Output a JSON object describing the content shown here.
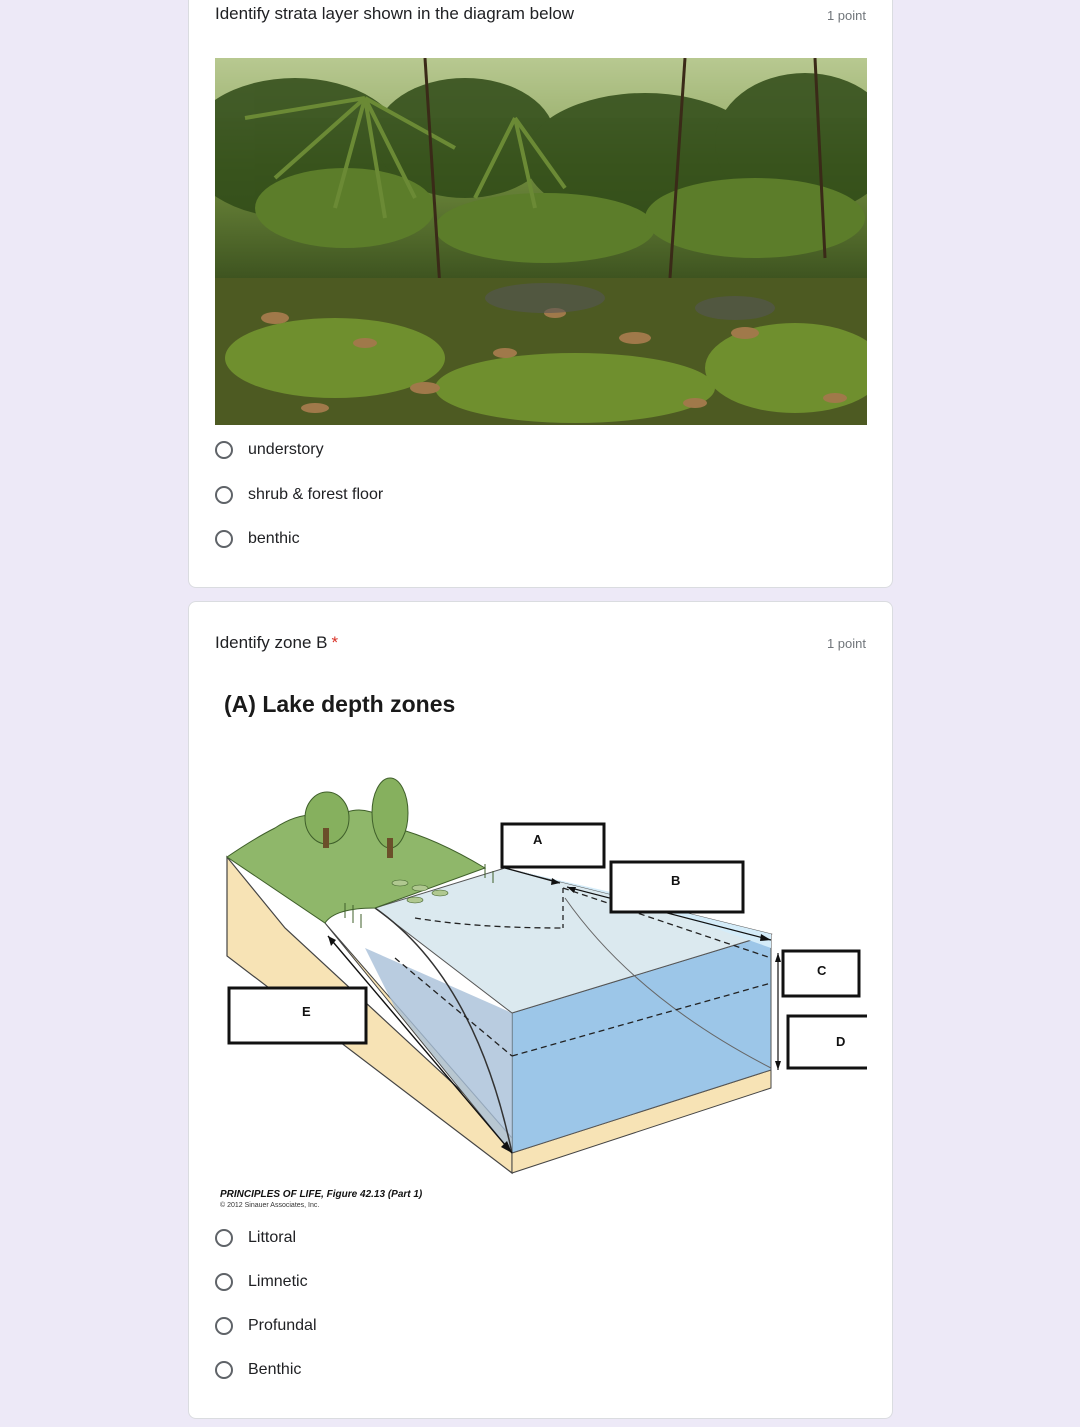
{
  "questions": [
    {
      "title": "Identify strata layer shown in the diagram below",
      "points": "1 point",
      "options": [
        "understory",
        "shrub & forest floor",
        "benthic"
      ]
    },
    {
      "title": "Identify zone B",
      "required_mark": "*",
      "points": "1 point",
      "figure": {
        "title": "(A)  Lake depth zones",
        "labels": [
          "A",
          "B",
          "C",
          "D",
          "E"
        ],
        "credit": "PRINCIPLES OF LIFE, Figure 42.13 (Part 1)",
        "copyright": "© 2012 Sinauer Associates, Inc."
      },
      "options": [
        "Littoral",
        "Limnetic",
        "Profundal",
        "Benthic"
      ]
    }
  ]
}
